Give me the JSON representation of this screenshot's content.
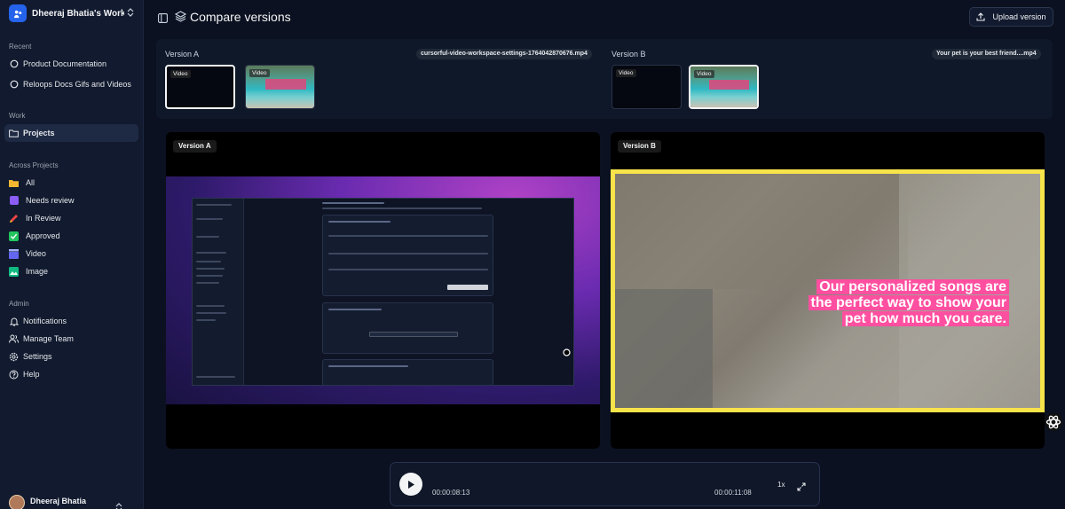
{
  "workspace": {
    "name": "Dheeraj Bhatia's Workspace",
    "display": "Dheeraj Bhatia's Worksp..."
  },
  "sidebar": {
    "recent_heading": "Recent",
    "recent": [
      {
        "label": "Product Documentation",
        "icon": "circle-icon"
      },
      {
        "label": "Reloops Docs Gifs and Videos",
        "icon": "circle-icon"
      }
    ],
    "work_heading": "Work",
    "work": [
      {
        "label": "Projects",
        "icon": "folder-icon",
        "active": true
      }
    ],
    "across_heading": "Across Projects",
    "across": [
      {
        "label": "All",
        "icon": "folder-yellow-icon",
        "color": "#f5b731"
      },
      {
        "label": "Needs review",
        "icon": "eyes-icon",
        "color": "#8b5cf6"
      },
      {
        "label": "In Review",
        "icon": "pencil-icon",
        "color": "#ef4444"
      },
      {
        "label": "Approved",
        "icon": "check-box-icon",
        "color": "#22c55e"
      },
      {
        "label": "Video",
        "icon": "clapper-icon",
        "color": "#6366f1"
      },
      {
        "label": "Image",
        "icon": "image-icon",
        "color": "#10b981"
      }
    ],
    "admin_heading": "Admin",
    "admin": [
      {
        "label": "Notifications",
        "icon": "bell-icon"
      },
      {
        "label": "Manage Team",
        "icon": "people-icon"
      },
      {
        "label": "Settings",
        "icon": "gear-icon"
      },
      {
        "label": "Help",
        "icon": "help-icon"
      }
    ],
    "user": {
      "name": "Dheeraj Bhatia"
    }
  },
  "header": {
    "title": "Compare versions",
    "upload_label": "Upload version"
  },
  "strip": {
    "version_a": {
      "label": "Version A",
      "filename": "cursorful-video-workspace-settings-1764042870676.mp4",
      "thumbs": [
        "Video",
        "Video"
      ]
    },
    "version_b": {
      "label": "Version B",
      "filename": "Your pet is your best friend....mp4",
      "thumbs": [
        "Video",
        "Video"
      ]
    }
  },
  "players": {
    "a": {
      "label": "Version A"
    },
    "b": {
      "label": "Version B",
      "caption": [
        "Our personalized songs are",
        "the perfect way to show your",
        "pet how much you care."
      ]
    }
  },
  "controls": {
    "current": "00:00:08:13",
    "total": "00:00:11:08",
    "speed": "1x"
  }
}
